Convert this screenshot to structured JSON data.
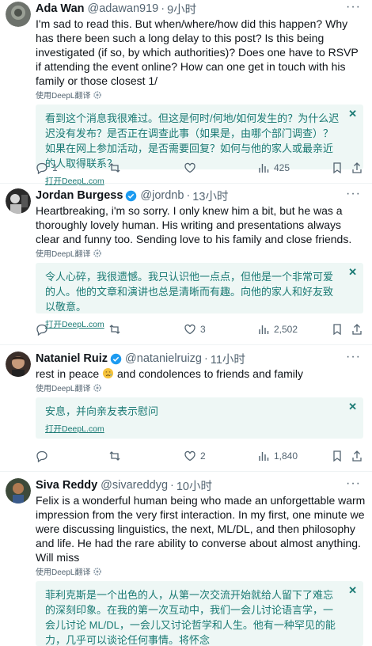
{
  "tweets": [
    {
      "name": "Ada Wan",
      "handle": "@adawan919",
      "time": "9小时",
      "text": "I'm sad to read this. But when/where/how did this happen? Why has there been such a long delay to this post? Is this being investigated (if so, by which authorities)? Does one have to RSVP if attending the event online? How can one get in touch with his family or those closest 1/",
      "translated_by": "使用DeepL翻译",
      "translation": "看到这个消息我很难过。但这是何时/何地/如何发生的？为什么迟迟没有发布？是否正在调查此事（如果是，由哪个部门调查）？如果在网上参加活动，是否需要回复？如何与他的家人或最亲近的人取得联系？",
      "open_deepl": "打开DeepL.com",
      "replies": "1",
      "retweets": "",
      "likes": "",
      "views": "425"
    },
    {
      "name": "Jordan Burgess",
      "handle": "@jordnb",
      "time": "13小时",
      "text": "Heartbreaking, i'm so sorry. I only knew him a bit, but he was a thoroughly lovely human. His writing and presentations always clear and funny too. Sending love to his family and close friends.",
      "translated_by": "使用DeepL翻译",
      "translation": "令人心碎，我很遗憾。我只认识他一点点，但他是一个非常可爱的人。他的文章和演讲也总是清晰而有趣。向他的家人和好友致以敬意。",
      "open_deepl": "打开DeepL.com",
      "replies": "",
      "retweets": "",
      "likes": "3",
      "views": "2,502"
    },
    {
      "name": "Nataniel Ruiz",
      "handle": "@natanielruizg",
      "time": "11小时",
      "text_before": "rest in peace ",
      "text_after": " and condolences to friends and family",
      "translated_by": "使用DeepL翻译",
      "translation": "安息，并向亲友表示慰问",
      "open_deepl": "打开DeepL.com",
      "replies": "",
      "retweets": "",
      "likes": "2",
      "views": "1,840"
    },
    {
      "name": "Siva Reddy",
      "handle": "@sivareddyg",
      "time": "10小时",
      "text": "Felix is a wonderful human being who made an unforgettable warm impression from the very first interaction. In my first, one minute we were discussing linguistics, the next, ML/DL, and then philosophy and life. He had the rare ability to converse about almost anything. Will miss",
      "translated_by": "使用DeepL翻译",
      "translation": "菲利克斯是一个出色的人，从第一次交流开始就给人留下了难忘的深刻印象。在我的第一次互动中，我们一会儿讨论语言学，一会儿讨论 ML/DL，一会儿又讨论哲学和人生。他有一种罕见的能力，几乎可以谈论任何事情。将怀念"
    }
  ],
  "colors": {
    "accent": "#1d9bf0",
    "deepl_text": "#1a7a74",
    "deepl_bg": "#eef7f5",
    "muted": "#536471"
  }
}
